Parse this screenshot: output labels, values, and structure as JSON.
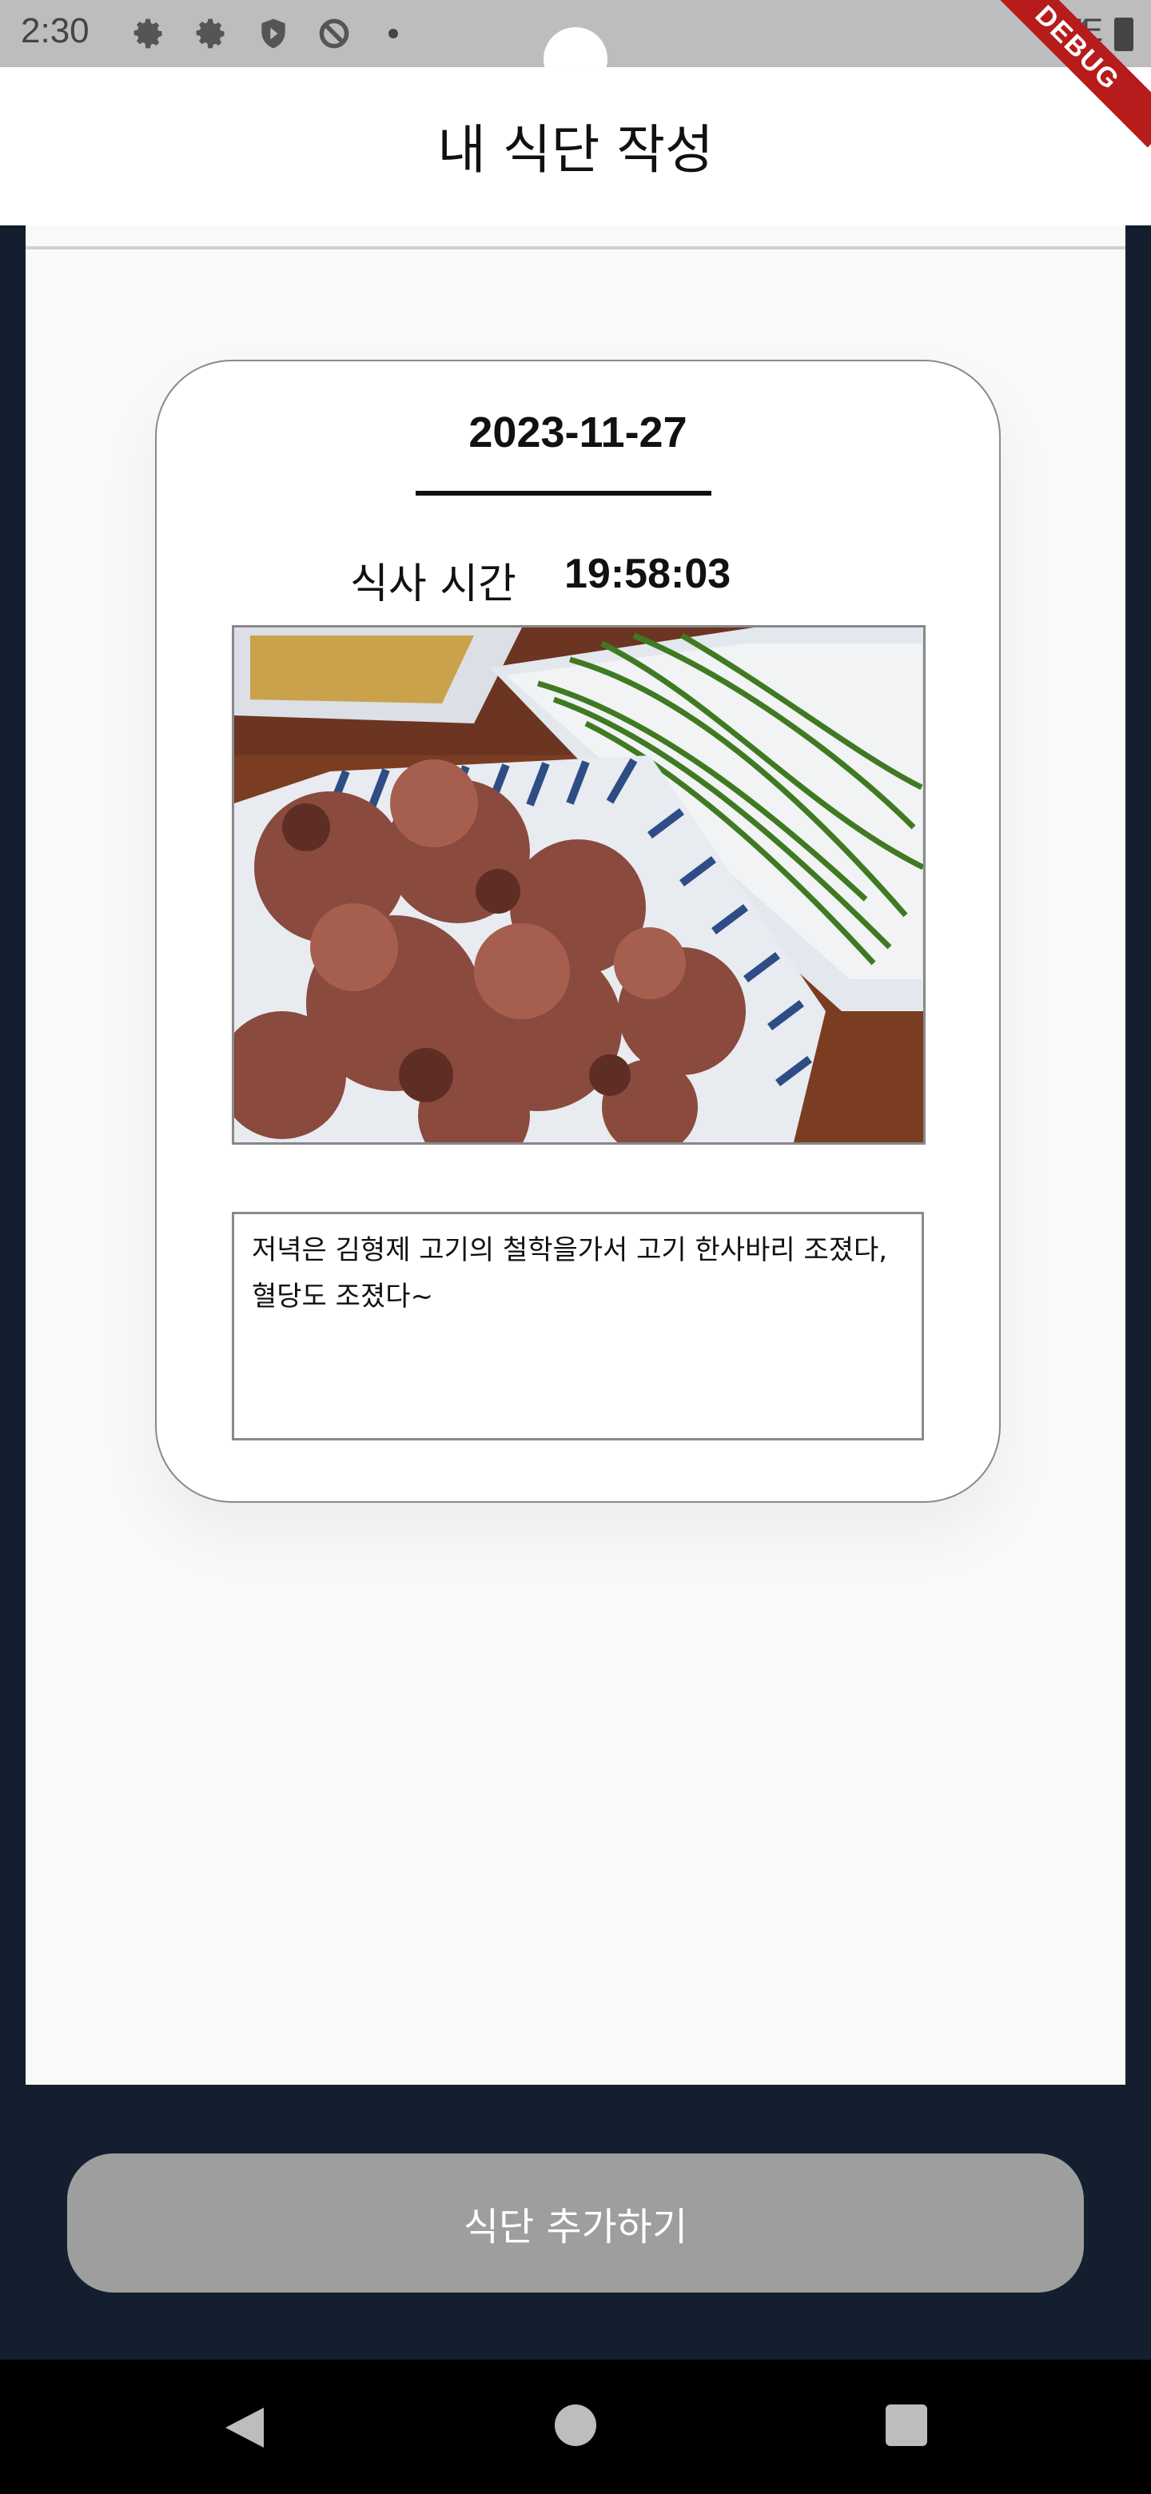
{
  "status_bar": {
    "time": "2:30",
    "network": "LTE",
    "icons": [
      "gear-icon",
      "gear-icon",
      "shield-icon",
      "no-data-icon",
      "dot-icon",
      "signal-icon",
      "battery-icon"
    ]
  },
  "debug_banner": "DEBUG",
  "app_bar": {
    "title": "내 식단 작성"
  },
  "card": {
    "date": "2023-11-27",
    "meal_time_label": "식사 시간",
    "meal_time": "19:58:03",
    "memo": "저녁은 김형제 고기의 철학을가서 고기 한사바리 조졌다,\n혈당도 조졌다~"
  },
  "add_button_label": "식단 추가하기",
  "nav": {
    "icons": [
      "back-icon",
      "home-icon",
      "recent-apps-icon"
    ]
  }
}
